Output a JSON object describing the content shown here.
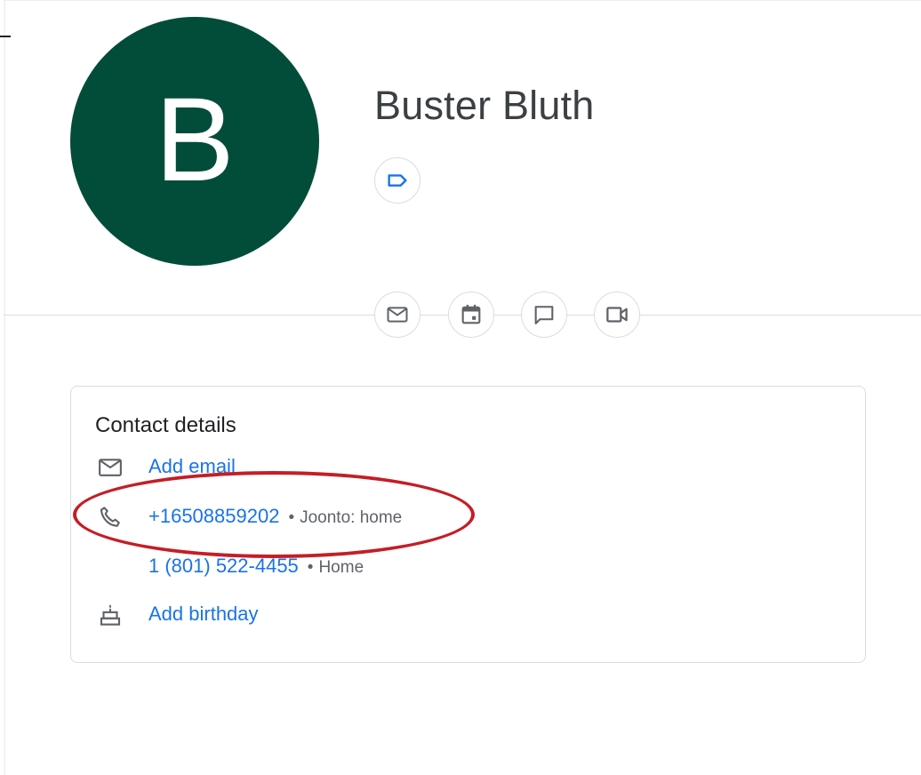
{
  "avatar": {
    "letter": "B",
    "color": "#024d3a"
  },
  "contact": {
    "name": "Buster Bluth"
  },
  "icons": {
    "label": "label-icon",
    "actions": [
      "email-icon",
      "calendar-event-icon",
      "chat-icon",
      "video-call-icon"
    ],
    "email": "email-icon",
    "phone": "phone-icon",
    "birthday": "cake-icon"
  },
  "details": {
    "title": "Contact details",
    "add_email": "Add email",
    "phones": [
      {
        "number": "+16508859202",
        "label": "Joonto: home"
      },
      {
        "number": "1 (801) 522-4455",
        "label": "Home"
      }
    ],
    "add_birthday": "Add birthday"
  },
  "colors": {
    "link": "#1a73e8",
    "annotation": "#c41e26",
    "icon": "#5f6368"
  }
}
